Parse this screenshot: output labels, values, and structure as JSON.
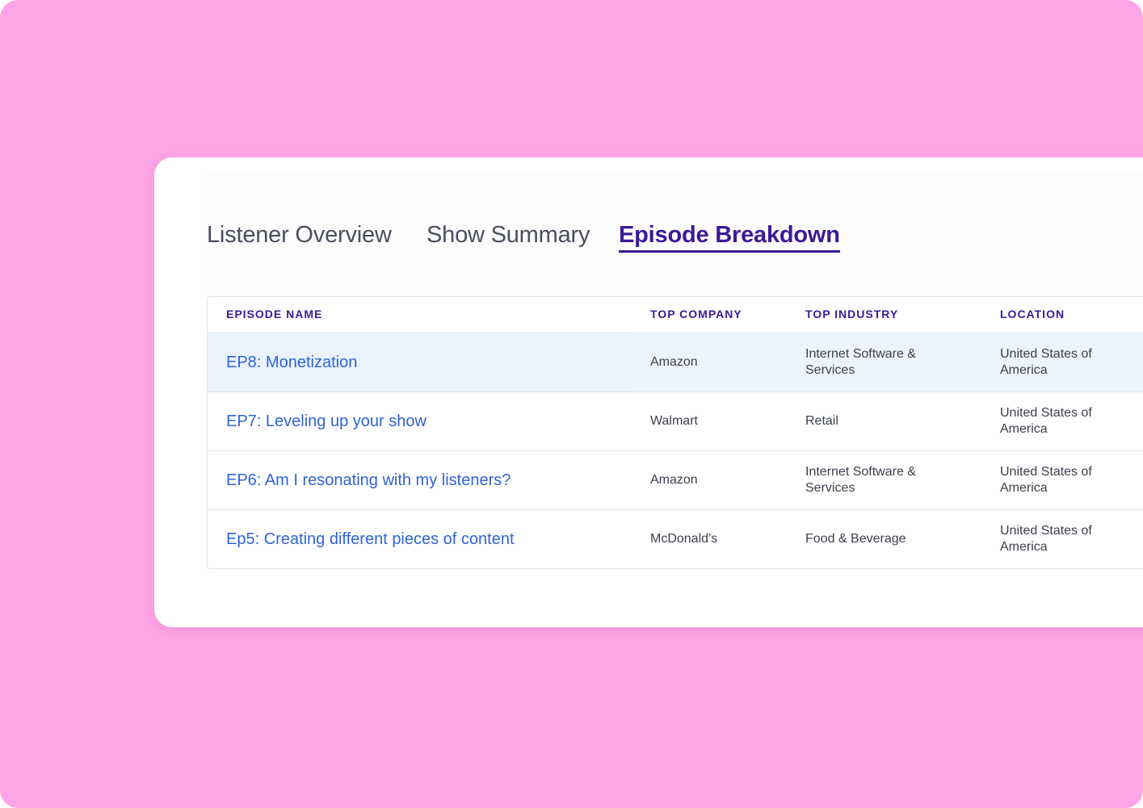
{
  "tabs": [
    {
      "label": "Listener Overview",
      "active": false
    },
    {
      "label": "Show Summary",
      "active": false
    },
    {
      "label": "Episode Breakdown",
      "active": true
    }
  ],
  "table": {
    "columns": [
      "EPISODE NAME",
      "TOP COMPANY",
      "TOP INDUSTRY",
      "LOCATION"
    ],
    "rows": [
      {
        "episode": "EP8: Monetization",
        "company": "Amazon",
        "industry": "Internet Software & Services",
        "location": "United States of America",
        "highlighted": true
      },
      {
        "episode": "EP7: Leveling up your show",
        "company": "Walmart",
        "industry": "Retail",
        "location": "United States of America",
        "highlighted": false
      },
      {
        "episode": "EP6: Am I resonating with my listeners?",
        "company": "Amazon",
        "industry": "Internet Software & Services",
        "location": "United States of America",
        "highlighted": false
      },
      {
        "episode": "Ep5: Creating different pieces of content",
        "company": "McDonald’s",
        "industry": "Food & Beverage",
        "location": "United States of America",
        "highlighted": false
      }
    ]
  },
  "colors": {
    "background": "#ffa4e6",
    "card": "#ffffff",
    "accent": "#3b1a96",
    "link": "#2f63d6",
    "row_highlight": "#eaf2fe"
  }
}
